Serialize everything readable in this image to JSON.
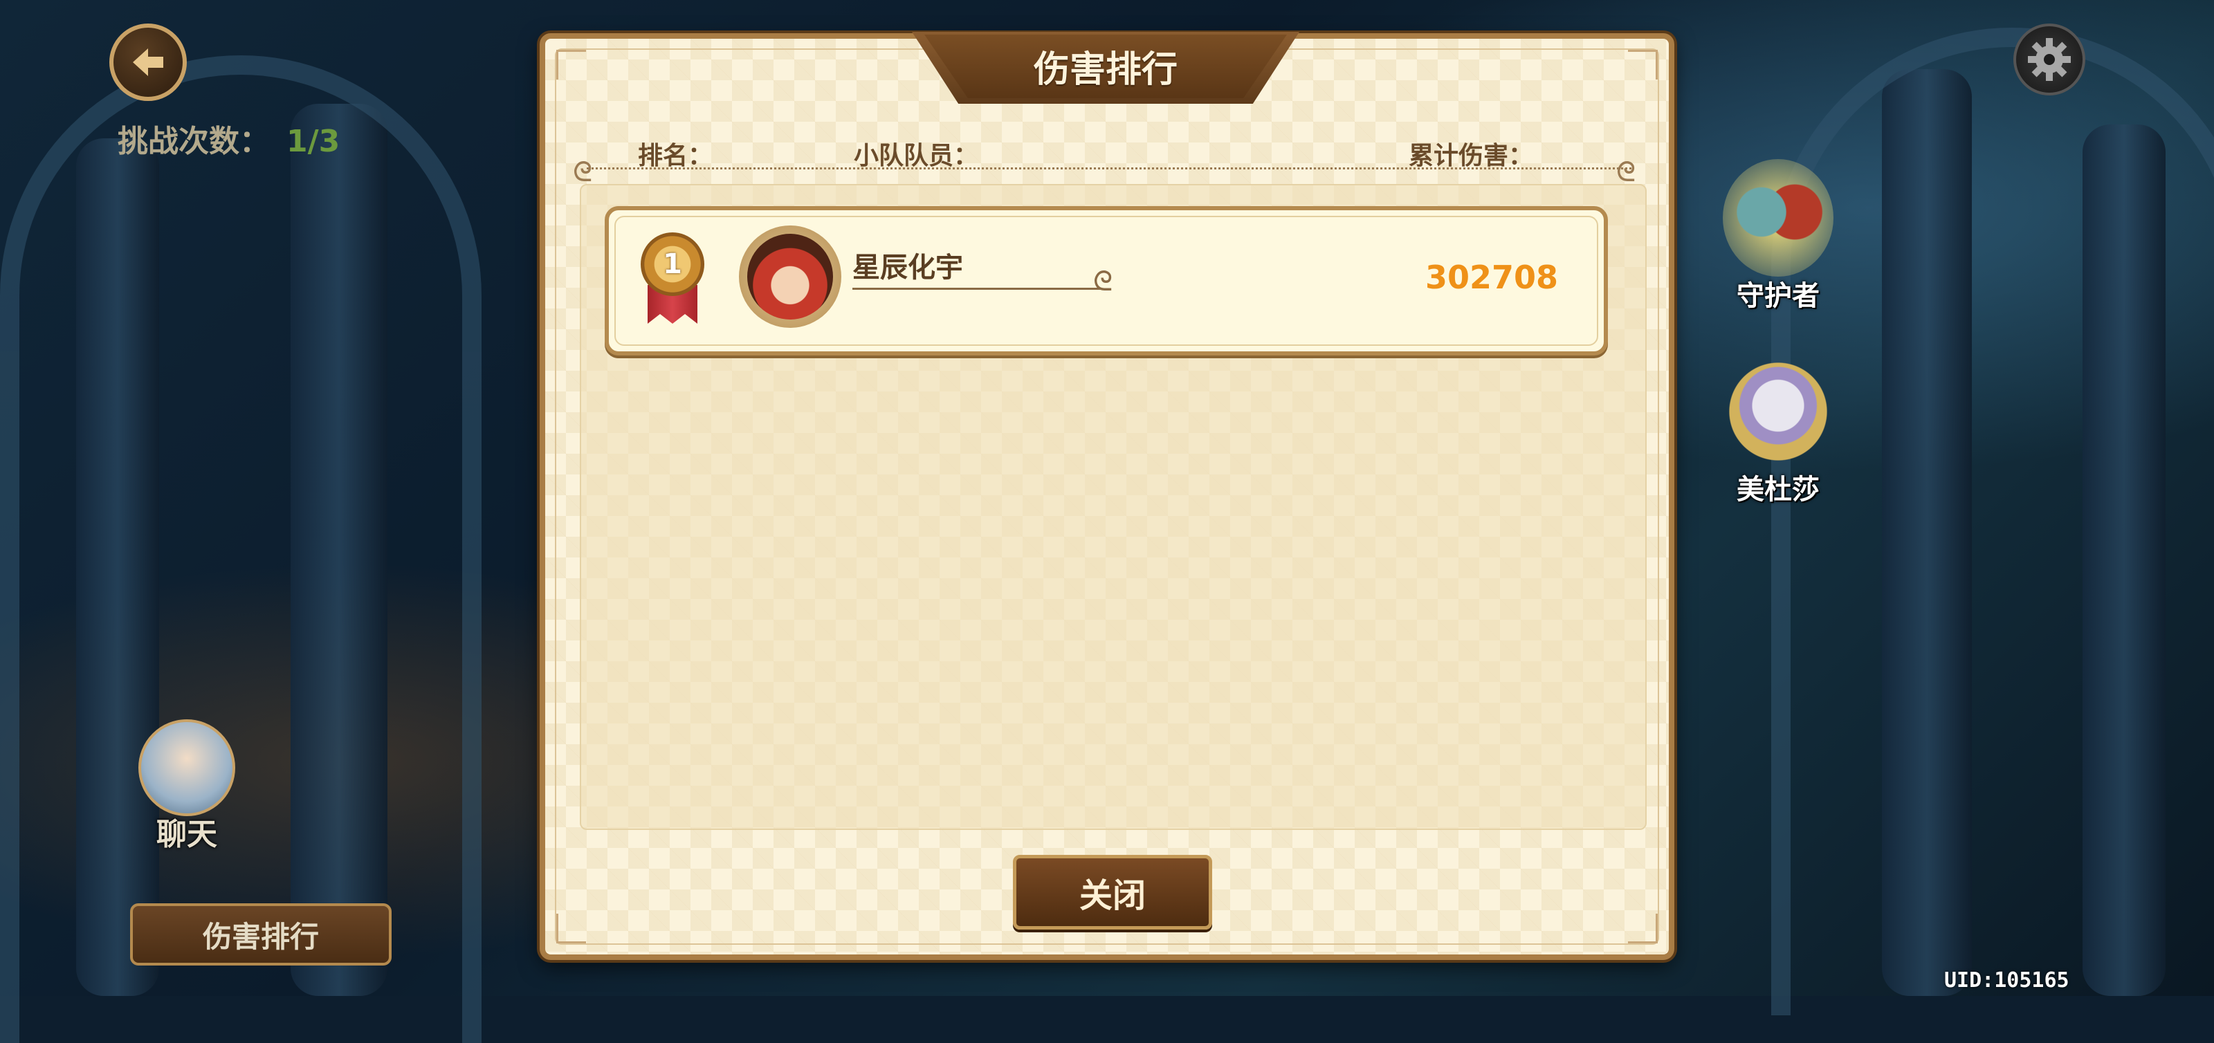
{
  "hud": {
    "challenge_label": "挑战次数：",
    "challenge_value": "1/3",
    "chat_label": "聊天",
    "damage_rank_button": "伤害排行",
    "uid": "UID:105165"
  },
  "side_characters": [
    {
      "label": "守护者"
    },
    {
      "label": "美杜莎"
    }
  ],
  "panel": {
    "title": "伤害排行",
    "headers": {
      "rank": "排名：",
      "members": "小队队员：",
      "damage": "累计伤害："
    },
    "rows": [
      {
        "rank": "1",
        "name": "星辰化宇",
        "damage": "302708"
      }
    ],
    "close_button": "关闭"
  },
  "colors": {
    "damage_value": "#ef9118",
    "panel_bg": "#fbf3dc",
    "frame": "#a97d45"
  }
}
